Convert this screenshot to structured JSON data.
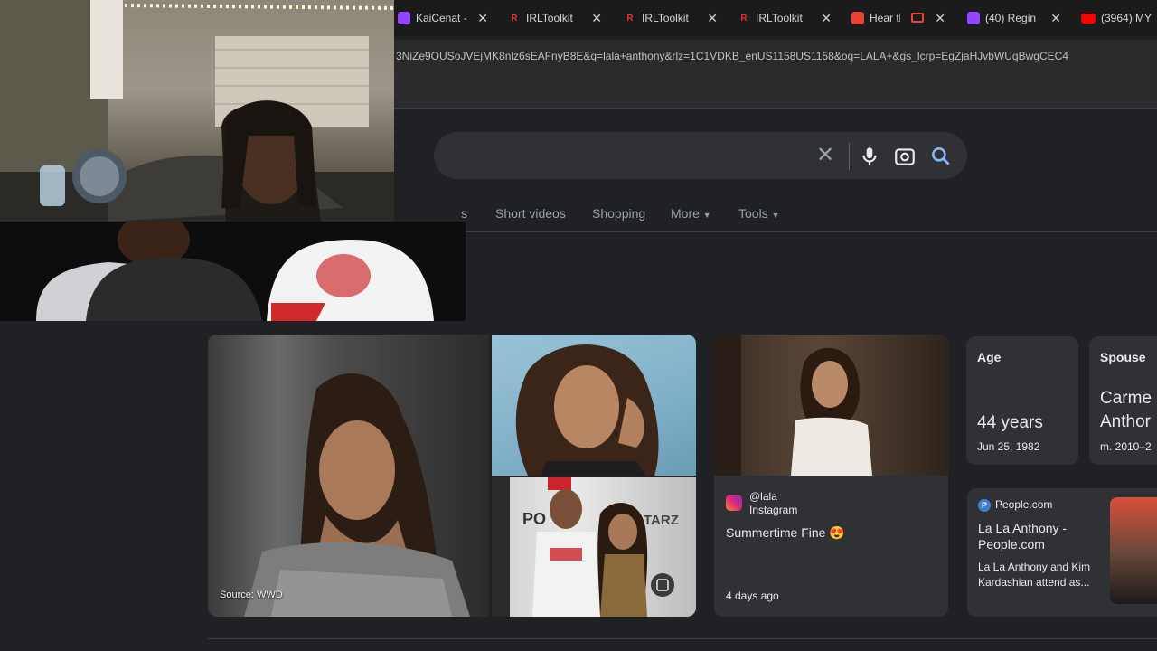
{
  "tabs": [
    {
      "title": "KaiCenat -",
      "favicon_color": "#9146ff",
      "icon": "twitch-icon"
    },
    {
      "title": "IRLToolkit",
      "favicon_color": "#e0312f",
      "icon": "irltoolkit-icon"
    },
    {
      "title": "IRLToolkit",
      "favicon_color": "#e0312f",
      "icon": "irltoolkit-icon"
    },
    {
      "title": "IRLToolkit",
      "favicon_color": "#e0312f",
      "icon": "irltoolkit-icon"
    },
    {
      "title": "Hear tl",
      "favicon_color": "#ea4335",
      "icon": "media-icon"
    },
    {
      "title": "(40) Regin",
      "favicon_color": "#9146ff",
      "icon": "twitch-icon"
    },
    {
      "title": "(3964) MY",
      "favicon_color": "#ff0000",
      "icon": "youtube-icon"
    }
  ],
  "url": "3NiZe9OUSoJVEjMK8nlz6sEAFnyB8E&q=lala+anthony&rlz=1C1VDKB_enUS1158US1158&oq=LALA+&gs_lcrp=EgZjaHJvbWUqBwgCEC4",
  "search_tabs": [
    "s",
    "Short videos",
    "Shopping",
    "More",
    "Tools"
  ],
  "images": {
    "source_label": "Source: WWD",
    "tarz_text": "TARZ",
    "po_text": "PO"
  },
  "instagram": {
    "handle": "@lala",
    "source": "Instagram",
    "caption": "Summertime Fine 😍",
    "time": "4 days ago"
  },
  "facts": {
    "age_label": "Age",
    "age_value": "44 years",
    "birth_date": "Jun 25, 1982",
    "spouse_label": "Spouse",
    "spouse_name_line1": "Carme",
    "spouse_name_line2": "Anthor",
    "spouse_years": "m. 2010–2"
  },
  "news": {
    "source": "People.com",
    "title": "La La Anthony - People.com",
    "snippet": "La La Anthony and Kim Kardashian attend as..."
  },
  "colors": {
    "bg": "#202124",
    "card": "#303134",
    "text": "#e8eaed",
    "muted": "#9aa0a6"
  }
}
